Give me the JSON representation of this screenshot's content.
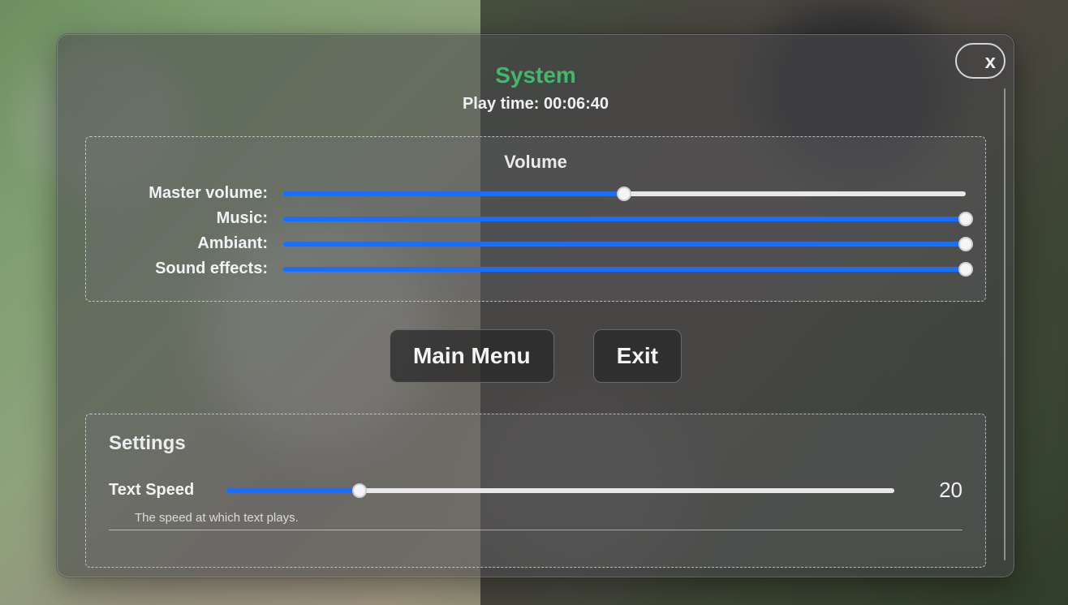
{
  "modal": {
    "title": "System",
    "playtime_label": "Play time: ",
    "playtime_value": "00:06:40",
    "close_label": "x"
  },
  "volume": {
    "section_title": "Volume",
    "sliders": [
      {
        "label": "Master volume:",
        "value": 50,
        "max": 100
      },
      {
        "label": "Music:",
        "value": 100,
        "max": 100
      },
      {
        "label": "Ambiant:",
        "value": 100,
        "max": 100
      },
      {
        "label": "Sound effects:",
        "value": 100,
        "max": 100
      }
    ]
  },
  "buttons": {
    "main_menu": "Main Menu",
    "exit": "Exit"
  },
  "settings": {
    "title": "Settings",
    "text_speed": {
      "label": "Text Speed",
      "value": 20,
      "max": 100,
      "description": "The speed at which text plays."
    }
  }
}
